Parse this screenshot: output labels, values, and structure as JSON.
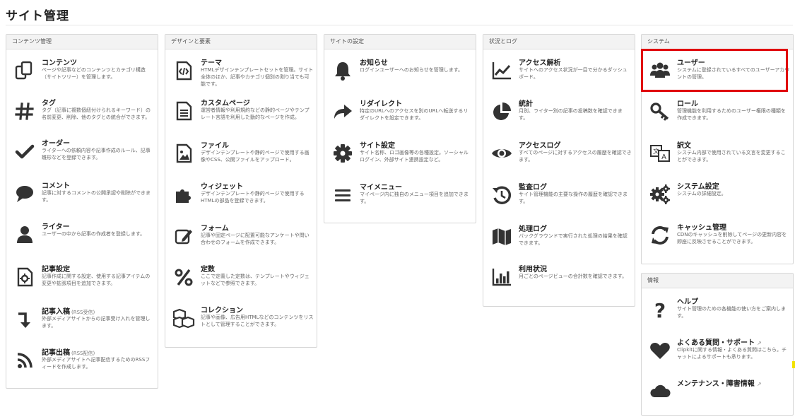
{
  "page_title": "サイト管理",
  "panels": [
    {
      "header": "コンテンツ管理",
      "items": [
        {
          "icon": "copy-icon",
          "title": "コンテンツ",
          "desc": "ページや記事などのコンテンツとカテゴリ構造（サイトツリー）を管理します。"
        },
        {
          "icon": "hashtag-icon",
          "title": "タグ",
          "desc": "タグ（記事に複数個紐付けられるキーワード）の名前変更、削除、他のタグとの統合ができます。"
        },
        {
          "icon": "check-icon",
          "title": "オーダー",
          "desc": "ライターへの依頼内容や記事作成のルール、記事雛形などを登録できます。"
        },
        {
          "icon": "comment-icon",
          "title": "コメント",
          "desc": "記事に対するコメントの公開承認や削除ができます。"
        },
        {
          "icon": "user-icon",
          "title": "ライター",
          "desc": "ユーザーの中から記事の作成者を登録します。"
        },
        {
          "icon": "article-settings-icon",
          "title": "記事設定",
          "desc": "記事作成に関する設定、使用する記事アイテムの変更や拡張項目を追加できます。"
        },
        {
          "icon": "import-arrow-icon",
          "title": "記事入稿",
          "title_sub": "(RSS受信)",
          "desc": "外部メディアサイトからの記事受け入れを管理します。"
        },
        {
          "icon": "rss-icon",
          "title": "記事出稿",
          "title_sub": "(RSS配信)",
          "desc": "外部メディアサイトへ記事配信するためのRSSフィードを作成します。"
        }
      ]
    },
    {
      "header": "デザインと要素",
      "items": [
        {
          "icon": "code-file-icon",
          "title": "テーマ",
          "desc": "HTMLデザインテンプレートセットを管理。サイト全体のほか、記事やカテゴリ個別の割り当ても可能です。"
        },
        {
          "icon": "text-file-icon",
          "title": "カスタムページ",
          "desc": "運営者情報や利用規約などの静的ページやテンプレート言語を利用した動的なページを作成。"
        },
        {
          "icon": "image-file-icon",
          "title": "ファイル",
          "desc": "デザインテンプレートや静的ページで使用する画像やCSS、公開ファイルをアップロード。"
        },
        {
          "icon": "puzzle-icon",
          "title": "ウィジェット",
          "desc": "デザインテンプレートや静的ページで使用するHTMLの部品を登録できます。"
        },
        {
          "icon": "edit-form-icon",
          "title": "フォーム",
          "desc": "記事や固定ページに配置可能なアンケートや問い合わせのフォームを作成できます。"
        },
        {
          "icon": "percent-icon",
          "title": "定数",
          "desc": "ここで定義した定数は、テンプレートやウィジェットなどで参照できます。"
        },
        {
          "icon": "cubes-icon",
          "title": "コレクション",
          "desc": "記事や画像、広告用HTMLなどのコンテンツをリストとして管理することができます。"
        }
      ]
    },
    {
      "header": "サイトの設定",
      "items": [
        {
          "icon": "bell-icon",
          "title": "お知らせ",
          "desc": "ログインユーザーへのお知らせを管理します。"
        },
        {
          "icon": "share-arrow-icon",
          "title": "リダイレクト",
          "desc": "特定のURLへのアクセスを別のURLへ転送するリダイレクトを設定できます。"
        },
        {
          "icon": "cog-icon",
          "title": "サイト設定",
          "desc": "サイト名称、ロゴ画像等の各種設定。ソーシャルログイン、外部サイト連携設定など。"
        },
        {
          "icon": "menu-icon",
          "title": "マイメニュー",
          "desc": "マイページ内に独自のメニュー項目を追加できます。"
        }
      ]
    },
    {
      "header": "状況とログ",
      "items": [
        {
          "icon": "line-chart-icon",
          "title": "アクセス解析",
          "desc": "サイトへのアクセス状況が一目で分かるダッシュボード。"
        },
        {
          "icon": "pie-chart-icon",
          "title": "統計",
          "desc": "月別、ライター別の記事の投稿数を確認できます。"
        },
        {
          "icon": "eye-icon",
          "title": "アクセスログ",
          "desc": "すべてのページに対するアクセスの履歴を確認できます。"
        },
        {
          "icon": "history-icon",
          "title": "監査ログ",
          "desc": "サイト管理機能の主要な操作の履歴を確認できます。"
        },
        {
          "icon": "map-icon",
          "title": "処理ログ",
          "desc": "バックグラウンドで実行された処理の結果を確認できます。"
        },
        {
          "icon": "bar-chart-icon",
          "title": "利用状況",
          "desc": "月ごとのページビューの合計数を確認できます。"
        }
      ]
    },
    {
      "header": "システム",
      "items": [
        {
          "icon": "users-icon",
          "title": "ユーザー",
          "desc": "システムに登録されているすべてのユーザーアカウントの管理。"
        },
        {
          "icon": "key-icon",
          "title": "ロール",
          "desc": "管理機能を利用するためのユーザー権限の種類を作成できます。"
        },
        {
          "icon": "translate-icon",
          "title": "訳文",
          "desc": "システム内部で使用されている文言を変更することができます。"
        },
        {
          "icon": "cogs-icon",
          "title": "システム設定",
          "desc": "システムの詳細設定。"
        },
        {
          "icon": "refresh-icon",
          "title": "キャッシュ管理",
          "desc": "CDNのキャッシュを削除してページの更新内容を即座に反映させることができます。"
        }
      ]
    },
    {
      "header": "情報",
      "items": [
        {
          "icon": "question-icon",
          "title": "ヘルプ",
          "desc": "サイト管理のための各機能の使い方をご案内します。"
        },
        {
          "icon": "heart-icon",
          "title": "よくある質問・サポート",
          "title_ext": "↗",
          "desc": "Clipkitに関する情報・よくある質問はこちら。チャットによるサポートも承ります。"
        },
        {
          "icon": "cloud-icon",
          "title": "メンテナンス・障害情報",
          "title_ext": "↗",
          "desc": ""
        }
      ]
    }
  ]
}
